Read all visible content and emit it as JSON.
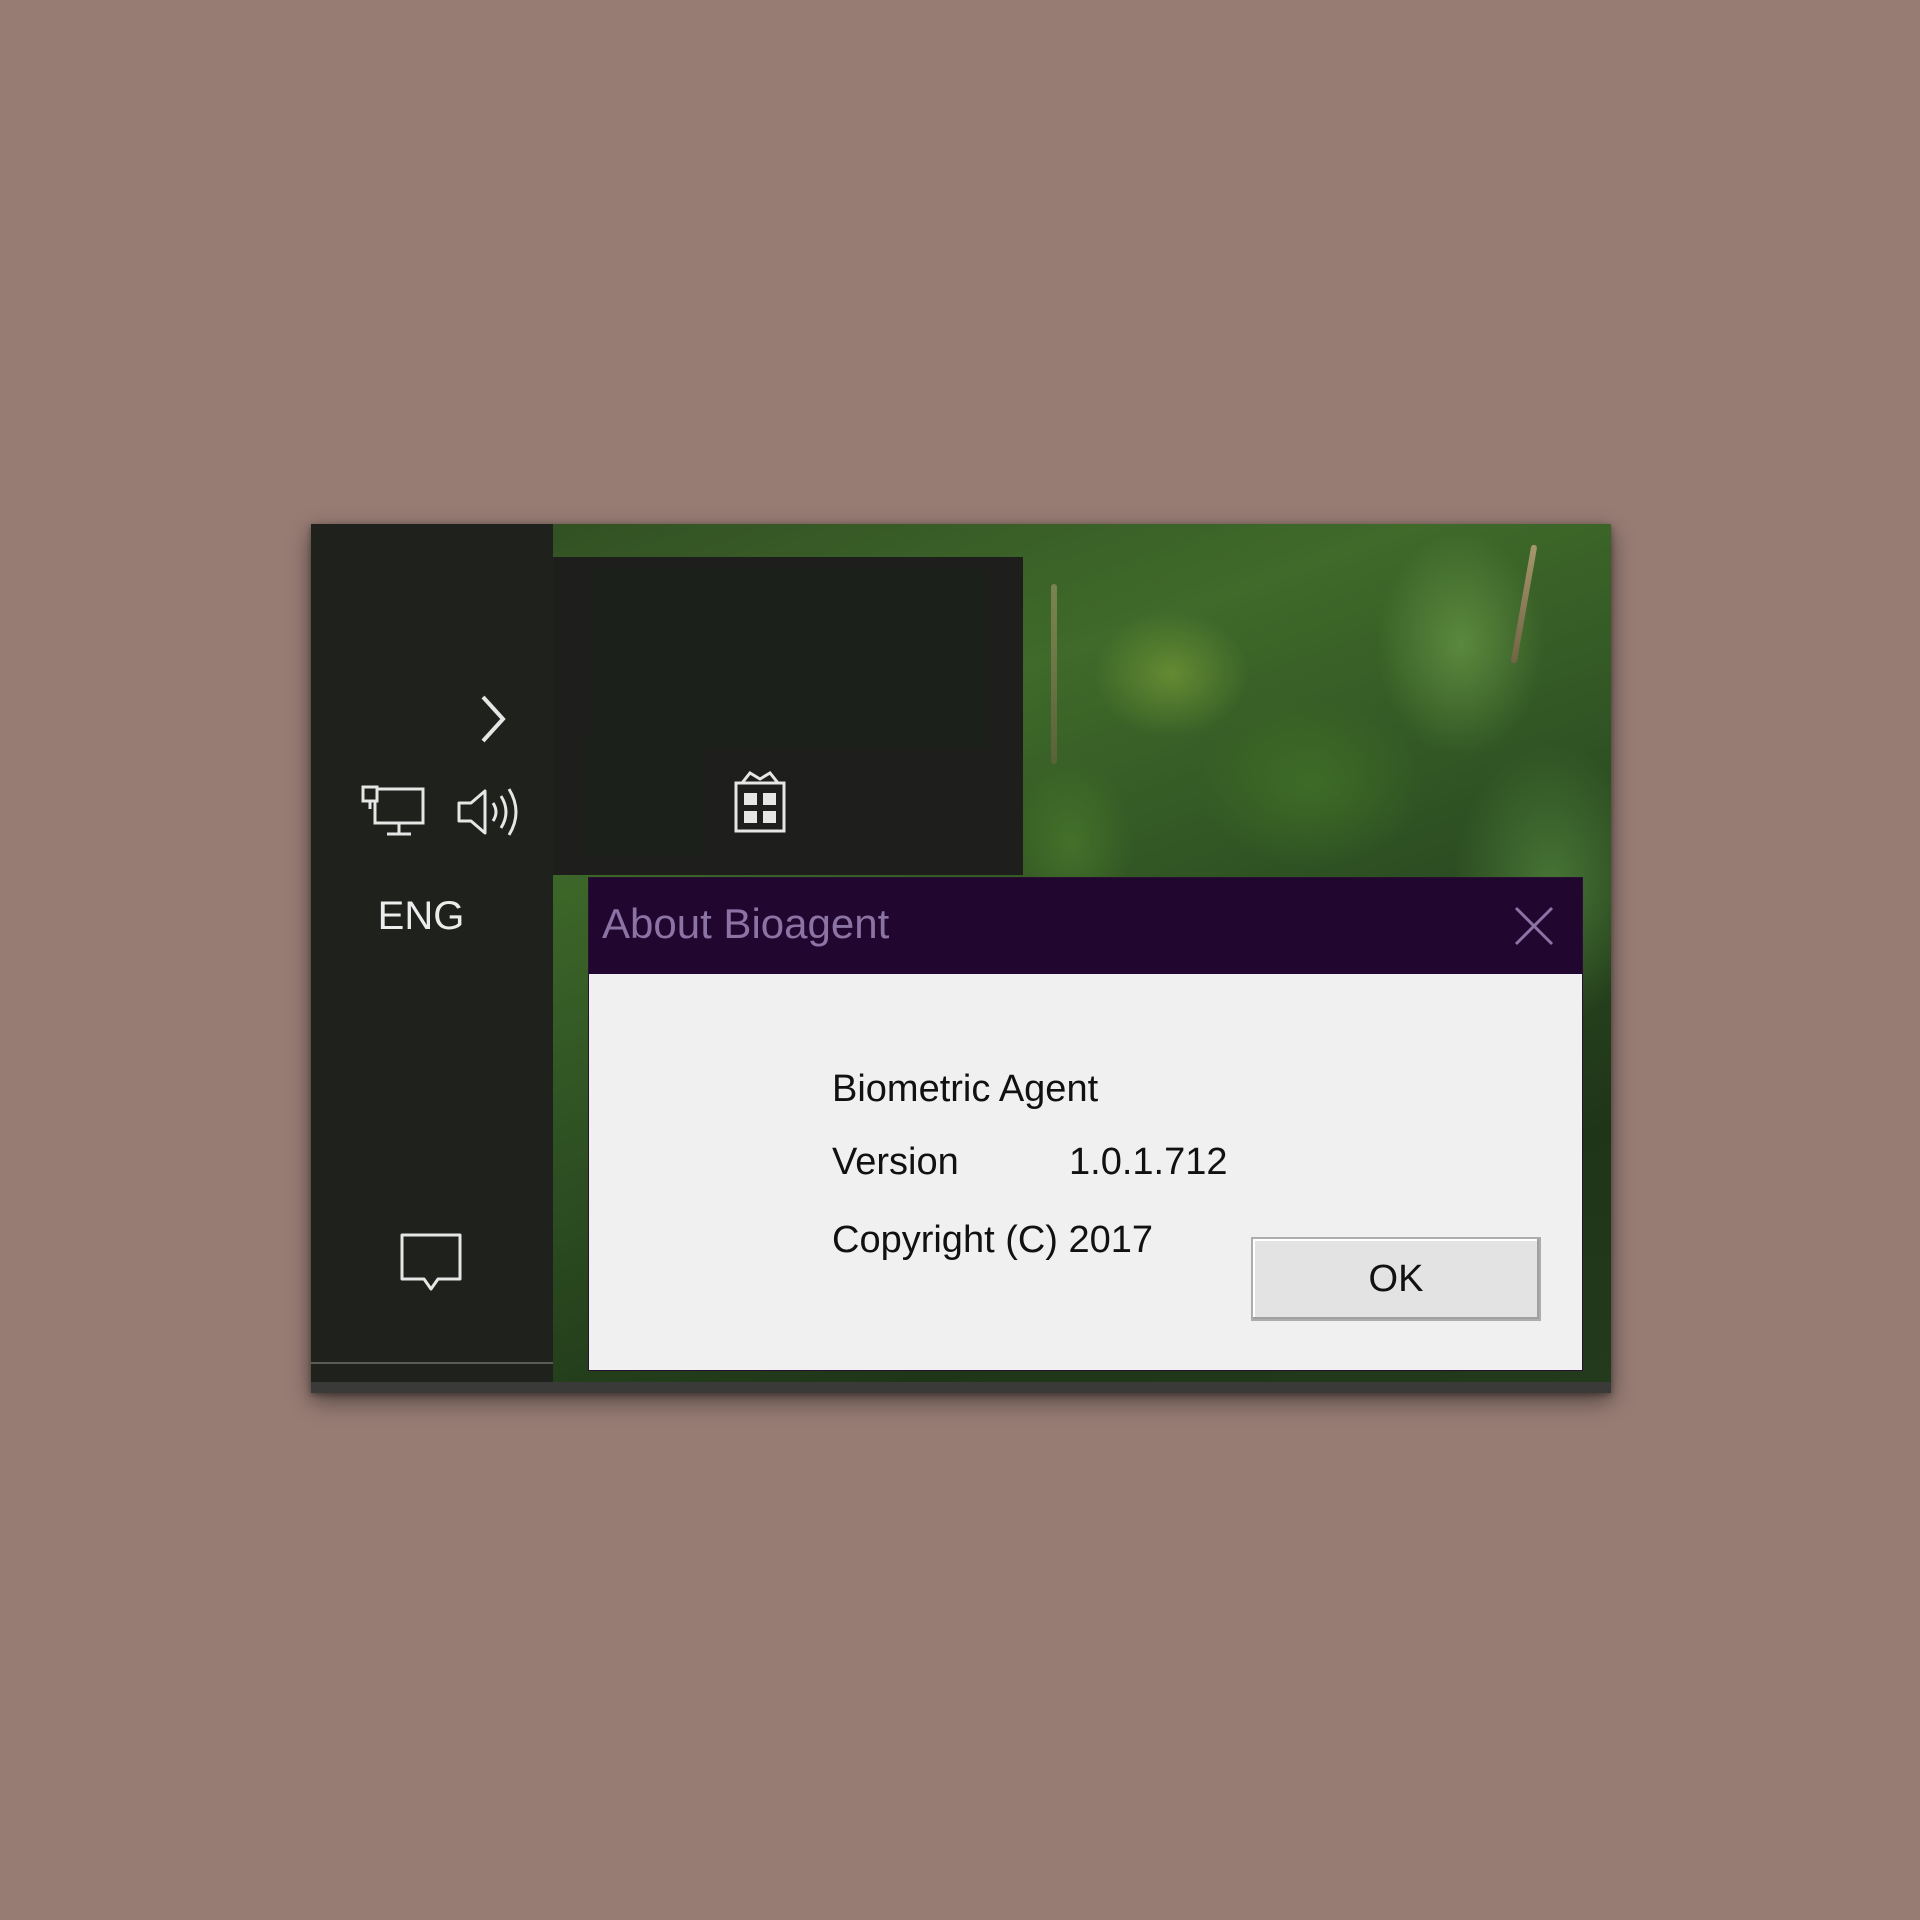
{
  "tray": {
    "chevron_icon": "chevron-right-icon",
    "network_icon": "network-monitor-icon",
    "volume_icon": "speaker-volume-icon",
    "language": "ENG",
    "notification_icon": "action-center-icon"
  },
  "flyout": {
    "app_icon": "bioagent-tray-icon"
  },
  "dialog": {
    "title": "About Bioagent",
    "product_name": "Biometric Agent",
    "version_label": "Version",
    "version_value": "1.0.1.712",
    "copyright": "Copyright (C) 2017",
    "ok_label": "OK",
    "titlebar_color": "#210630",
    "title_color": "#8b74a4"
  }
}
